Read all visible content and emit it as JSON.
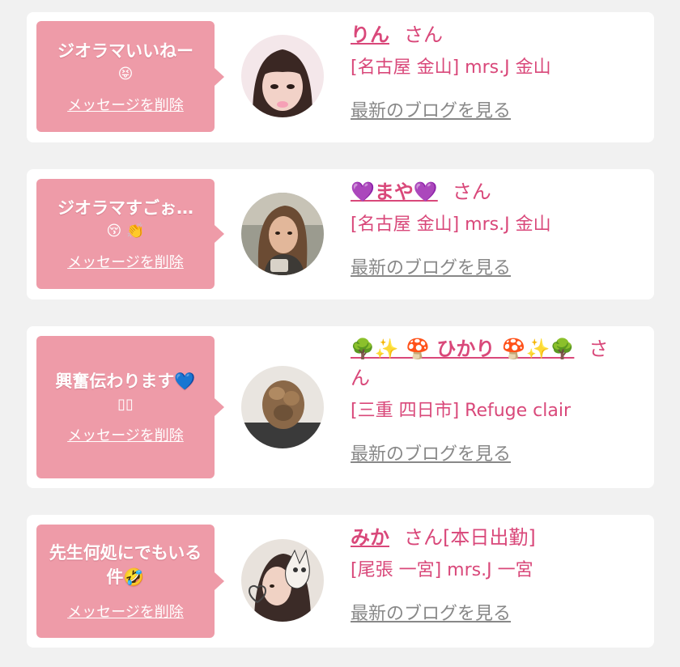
{
  "delete_label": "メッセージを削除",
  "blog_label": "最新のブログを見る",
  "san_label": "さん",
  "colors": {
    "bubble": "#ee9ba8",
    "name": "#d9487a",
    "link": "#888888",
    "background": "#f1f1f1"
  },
  "messages": [
    {
      "message": "ジオラマいいねー",
      "emoji": "😝",
      "name": "りん",
      "suffix": "",
      "shop": "[名古屋 金山] mrs.J 金山",
      "avatar": "avatar-woman-bangs"
    },
    {
      "message": "ジオラマすごぉ…",
      "emoji": "😚 👏",
      "name": "💜まや💜",
      "suffix": "",
      "shop": "[名古屋 金山] mrs.J 金山",
      "avatar": "avatar-woman-long-hair"
    },
    {
      "message": "興奮伝わります💙",
      "emoji": "▯▯",
      "name": "🌳✨ 🍄 ひかり 🍄✨🌳",
      "suffix": "",
      "shop": "[三重 四日市] Refuge clair",
      "avatar": "avatar-hairstyle-back"
    },
    {
      "message": "先生何処にでもいる件🤣",
      "emoji": "",
      "name": "みか",
      "suffix": "[本日出勤]",
      "shop": "[尾張 一宮] mrs.J 一宮",
      "avatar": "avatar-woman-cat-sticker"
    }
  ]
}
